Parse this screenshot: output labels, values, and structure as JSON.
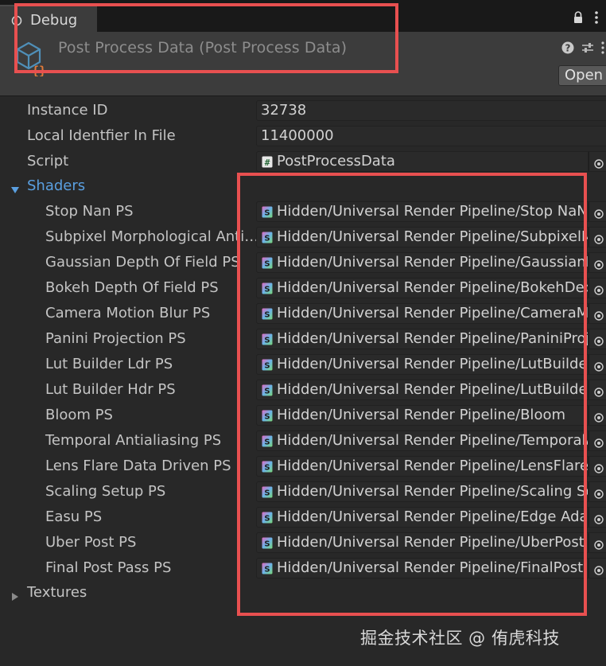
{
  "tab": {
    "label": "Debug"
  },
  "header": {
    "title": "Post Process Data (Post Process Data)",
    "open_label": "Open"
  },
  "fields": [
    {
      "label": "Instance ID",
      "value": "32738"
    },
    {
      "label": "Local Identfier In File",
      "value": "11400000"
    }
  ],
  "script": {
    "label": "Script",
    "value": "PostProcessData"
  },
  "shaders": {
    "label": "Shaders",
    "expanded": true,
    "items": [
      {
        "label": "Stop Nan PS",
        "value": "Hidden/Universal Render Pipeline/Stop NaN"
      },
      {
        "label": "Subpixel Morphological Anti…",
        "value": "Hidden/Universal Render Pipeline/SubpixelMo"
      },
      {
        "label": "Gaussian Depth Of Field PS",
        "value": "Hidden/Universal Render Pipeline/GaussianDe"
      },
      {
        "label": "Bokeh Depth Of Field PS",
        "value": "Hidden/Universal Render Pipeline/BokehDepth"
      },
      {
        "label": "Camera Motion Blur PS",
        "value": "Hidden/Universal Render Pipeline/CameraMoti"
      },
      {
        "label": "Panini Projection PS",
        "value": "Hidden/Universal Render Pipeline/PaniniProjec"
      },
      {
        "label": "Lut Builder Ldr PS",
        "value": "Hidden/Universal Render Pipeline/LutBuilderLd"
      },
      {
        "label": "Lut Builder Hdr PS",
        "value": "Hidden/Universal Render Pipeline/LutBuilderHd"
      },
      {
        "label": "Bloom PS",
        "value": "Hidden/Universal Render Pipeline/Bloom"
      },
      {
        "label": "Temporal Antialiasing PS",
        "value": "Hidden/Universal Render Pipeline/TemporalAA"
      },
      {
        "label": "Lens Flare Data Driven PS",
        "value": "Hidden/Universal Render Pipeline/LensFlareDa"
      },
      {
        "label": "Scaling Setup PS",
        "value": "Hidden/Universal Render Pipeline/Scaling Setu"
      },
      {
        "label": "Easu PS",
        "value": "Hidden/Universal Render Pipeline/Edge Adapti"
      },
      {
        "label": "Uber Post PS",
        "value": "Hidden/Universal Render Pipeline/UberPost"
      },
      {
        "label": "Final Post Pass PS",
        "value": "Hidden/Universal Render Pipeline/FinalPost"
      }
    ]
  },
  "textures": {
    "label": "Textures",
    "expanded": false
  },
  "watermark": "掘金技术社区 @ 侑虎科技",
  "colors": {
    "annotation": "#e85050",
    "foldout_selected": "#5a9fe0",
    "panel_bg": "#282828",
    "header_bg": "#3c3c3c"
  },
  "icons": {
    "tab": "debug-inspector-icon",
    "asset": "scriptable-object-icon",
    "script": "csharp-script-icon",
    "shader": "shader-icon",
    "picker": "object-picker-icon"
  }
}
